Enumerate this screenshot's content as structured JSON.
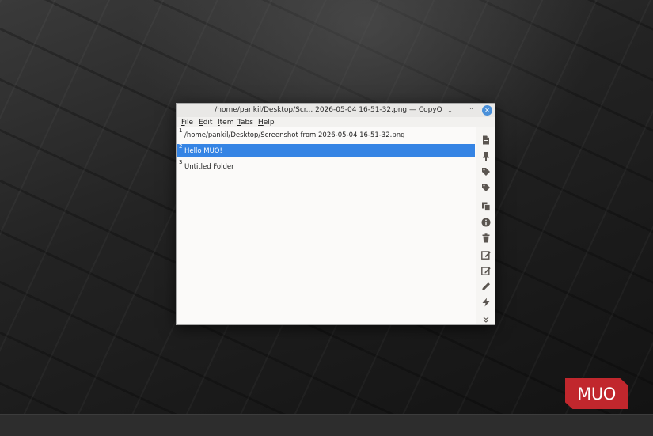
{
  "window": {
    "title": "/home/pankil/Desktop/Scr... 2026-05-04 16-51-32.png — CopyQ",
    "minimize_glyph": "⌄",
    "maximize_glyph": "⌃",
    "close_glyph": "✕"
  },
  "menu": [
    {
      "u": "F",
      "rest": "ile"
    },
    {
      "u": "E",
      "rest": "dit"
    },
    {
      "u": "I",
      "rest": "tem"
    },
    {
      "u": "T",
      "rest": "abs"
    },
    {
      "u": "H",
      "rest": "elp"
    }
  ],
  "items": [
    {
      "num": "1",
      "text": "/home/pankil/Desktop/Screenshot from 2026-05-04 16-51-32.png",
      "selected": false
    },
    {
      "num": "2",
      "text": "Hello MUO!",
      "selected": true
    },
    {
      "num": "3",
      "text": "Untitled Folder",
      "selected": false
    }
  ],
  "toolbar_icons": [
    "new-item-icon",
    "pin-icon",
    "tag-icon",
    "tag-icon",
    "copy-icon",
    "info-icon",
    "trash-icon",
    "edit-icon",
    "edit-external-icon",
    "pencil-icon",
    "bolt-icon",
    "chevron-down-icon"
  ],
  "watermark": {
    "text": "MUO",
    "color": "#c1272d"
  },
  "colors": {
    "selection": "#3584e4",
    "accent": "#4a90d9"
  }
}
